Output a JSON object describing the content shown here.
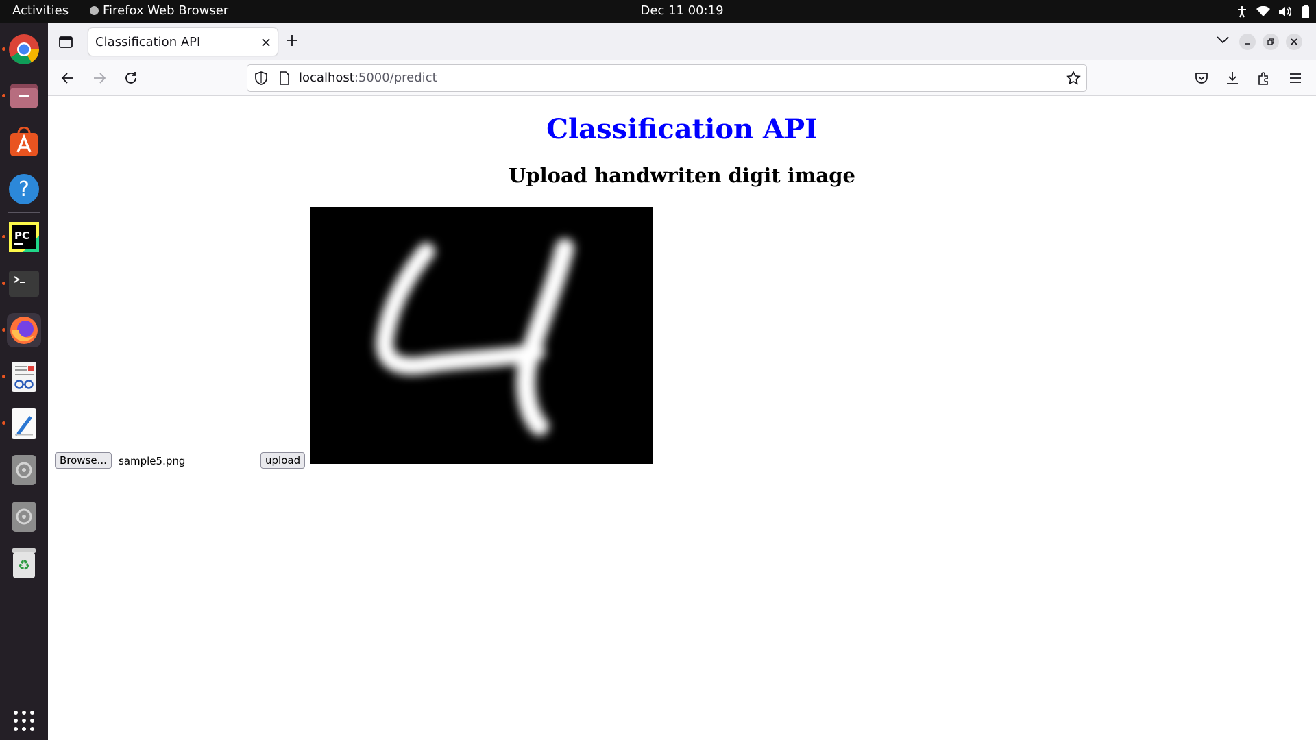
{
  "system_bar": {
    "activities_label": "Activities",
    "app_name": "Firefox Web Browser",
    "datetime": "Dec 11  00:19",
    "tray_icons": [
      "accessibility-icon",
      "wifi-icon",
      "volume-icon",
      "battery-icon"
    ]
  },
  "dock": {
    "apps": [
      {
        "name": "Google Chrome",
        "icon": "chrome-icon",
        "running": true
      },
      {
        "name": "Files",
        "icon": "files-icon",
        "running": true
      },
      {
        "name": "Ubuntu Software",
        "icon": "software-icon",
        "running": false
      },
      {
        "name": "Help",
        "icon": "help-icon",
        "running": false
      },
      {
        "name": "PyCharm",
        "icon": "pycharm-icon",
        "running": true
      },
      {
        "name": "Terminal",
        "icon": "terminal-icon",
        "running": true
      },
      {
        "name": "Firefox",
        "icon": "firefox-icon",
        "running": true,
        "active": true
      },
      {
        "name": "Document Viewer",
        "icon": "document-viewer-icon",
        "running": true
      },
      {
        "name": "Text Editor",
        "icon": "text-editor-icon",
        "running": true
      },
      {
        "name": "Disc 1",
        "icon": "disc-icon",
        "running": false
      },
      {
        "name": "Disc 2",
        "icon": "disc-icon",
        "running": false
      },
      {
        "name": "Trash",
        "icon": "trash-icon",
        "running": false
      }
    ],
    "show_apps_icon": "app-grid-icon"
  },
  "browser": {
    "tab_title": "Classification API",
    "url_host": "localhost",
    "url_rest": ":5000/predict"
  },
  "page": {
    "title": "Classification API",
    "subtitle": "Upload handwriten digit image",
    "browse_label": "Browse...",
    "file_name": "sample5.png",
    "upload_label": "upload",
    "preview_image": "handwritten-digit-image"
  },
  "colors": {
    "title": "#0000ff",
    "topbar": "#111111",
    "dock": "#241f26",
    "running_indicator": "#e95420"
  }
}
